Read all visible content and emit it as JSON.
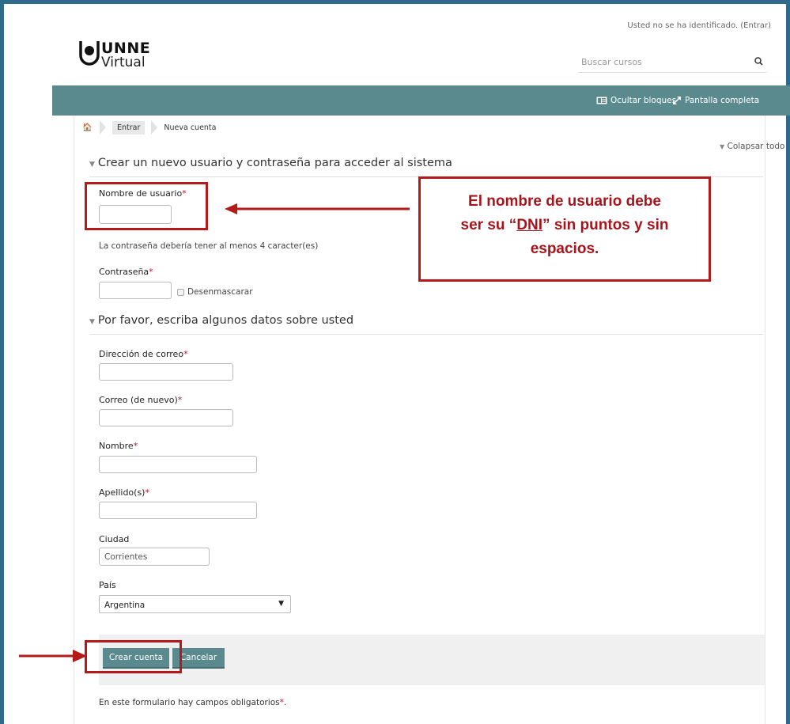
{
  "header": {
    "login_status": "Usted no se ha identificado. (Entrar)",
    "logo_line1": "UNNE",
    "logo_line2": "Virtual",
    "search_placeholder": "Buscar cursos"
  },
  "navbar": {
    "hide_blocks": "Ocultar bloques",
    "fullscreen": "Pantalla completa"
  },
  "breadcrumb": {
    "items": [
      "Entrar",
      "Nueva cuenta"
    ]
  },
  "collapse_all": "Colapsar todo",
  "sections": {
    "account_legend": "Crear un nuevo usuario y contraseña para acceder al sistema",
    "details_legend": "Por favor, escriba algunos datos sobre usted"
  },
  "fields": {
    "username_label": "Nombre de usuario",
    "password_help": "La contraseña debería tener al menos 4 caracter(es)",
    "password_label": "Contraseña",
    "unmask_label": "Desenmascarar",
    "email_label": "Dirección de correo",
    "email2_label": "Correo (de nuevo)",
    "firstname_label": "Nombre",
    "lastname_label": "Apellido(s)",
    "city_label": "Ciudad",
    "city_value": "Corrientes",
    "country_label": "País",
    "country_value": "Argentina",
    "required_marker": "*"
  },
  "buttons": {
    "create": "Crear cuenta",
    "cancel": "Cancelar"
  },
  "required_note": "En este formulario hay campos obligatorios",
  "annotation": {
    "line1": "El nombre de usuario debe",
    "line2_pre": "ser su “",
    "line2_dni": "DNI",
    "line2_post": "” sin puntos y sin",
    "line3": "espacios."
  },
  "colors": {
    "navbar": "#5a8a8e",
    "annotation_red": "#b41a1a",
    "required_red": "#c8102e"
  }
}
